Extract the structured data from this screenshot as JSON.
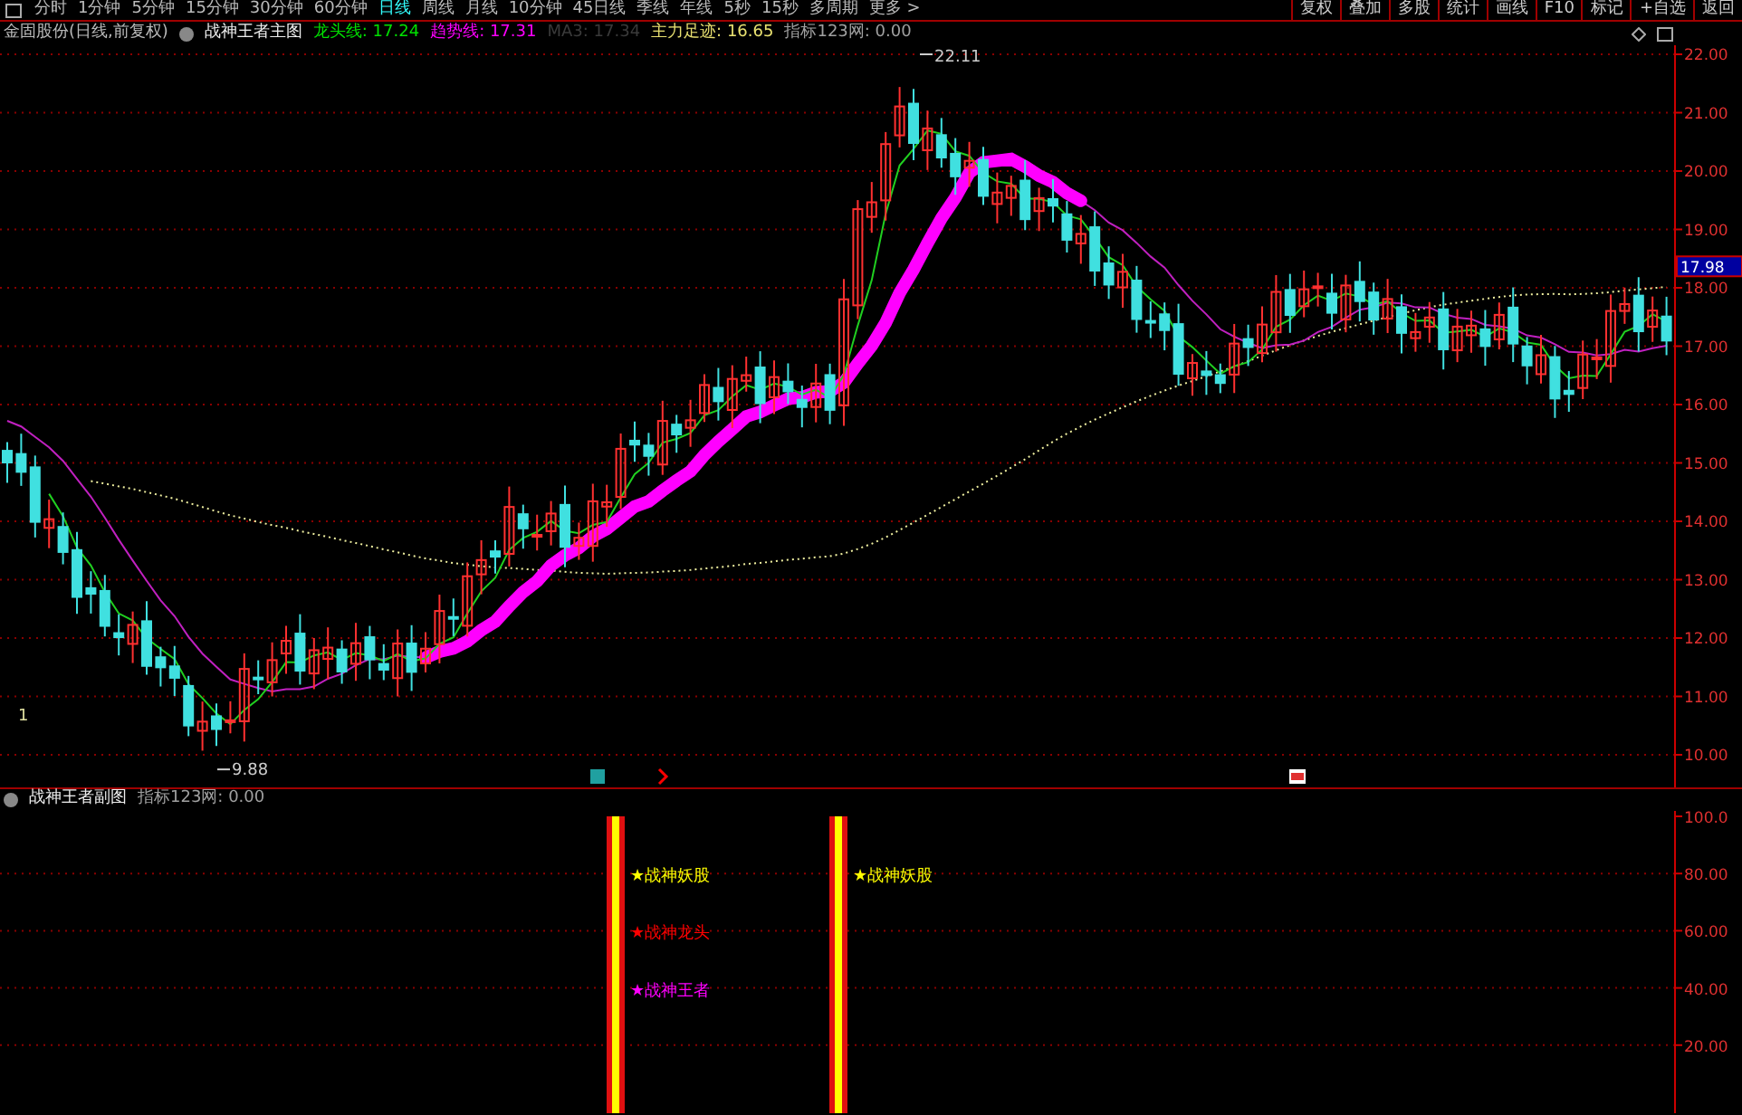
{
  "toolbar": {
    "periods": [
      {
        "label": "分时",
        "selected": false
      },
      {
        "label": "1分钟",
        "selected": false
      },
      {
        "label": "5分钟",
        "selected": false
      },
      {
        "label": "15分钟",
        "selected": false
      },
      {
        "label": "30分钟",
        "selected": false
      },
      {
        "label": "60分钟",
        "selected": false
      },
      {
        "label": "日线",
        "selected": true
      },
      {
        "label": "周线",
        "selected": false
      },
      {
        "label": "月线",
        "selected": false
      },
      {
        "label": "10分钟",
        "selected": false
      },
      {
        "label": "45日线",
        "selected": false
      },
      {
        "label": "季线",
        "selected": false
      },
      {
        "label": "年线",
        "selected": false
      },
      {
        "label": "5秒",
        "selected": false
      },
      {
        "label": "15秒",
        "selected": false
      },
      {
        "label": "多周期",
        "selected": false
      },
      {
        "label": "更多 >",
        "selected": false
      }
    ],
    "buttons": [
      "复权",
      "叠加",
      "多股",
      "统计",
      "画线",
      "F10",
      "标记",
      "+自选",
      "返回"
    ]
  },
  "main_legend": {
    "security": "金固股份(日线,前复权)",
    "indicator": "战神王者主图",
    "values": [
      {
        "label": "龙头线: 17.24",
        "color": "#00e000"
      },
      {
        "label": "趋势线: 17.31",
        "color": "#ff00ff"
      },
      {
        "label": "MA3: 17.34",
        "color": "#3a3a3a"
      },
      {
        "label": "主力足迹: 16.65",
        "color": "#e8e070"
      },
      {
        "label": "指标123网: 0.00",
        "color": "#a0a0a0"
      }
    ]
  },
  "main_chart": {
    "y_axis_labels": [
      "22.00",
      "21.00",
      "20.00",
      "19.00",
      "18.00",
      "17.00",
      "16.00",
      "15.00",
      "14.00",
      "13.00",
      "12.00",
      "11.00",
      "10.00"
    ],
    "current_price": "17.98",
    "high_label": "22.11",
    "low_label": "9.88",
    "marker": "1"
  },
  "sub_legend": {
    "indicator": "战神王者副图",
    "values": [
      {
        "label": "指标123网: 0.00",
        "color": "#a0a0a0"
      }
    ]
  },
  "sub_chart": {
    "y_axis_labels": [
      "100.0",
      "80.00",
      "60.00",
      "40.00",
      "20.00"
    ],
    "signal_columns": [
      {
        "labels": [
          {
            "text": "★战神妖股",
            "color": "#ffff00"
          },
          {
            "text": "★战神龙头",
            "color": "#ff0000"
          },
          {
            "text": "★战神王者",
            "color": "#ff00ff"
          }
        ]
      },
      {
        "labels": [
          {
            "text": "★战神妖股",
            "color": "#ffff00"
          }
        ]
      }
    ]
  }
}
